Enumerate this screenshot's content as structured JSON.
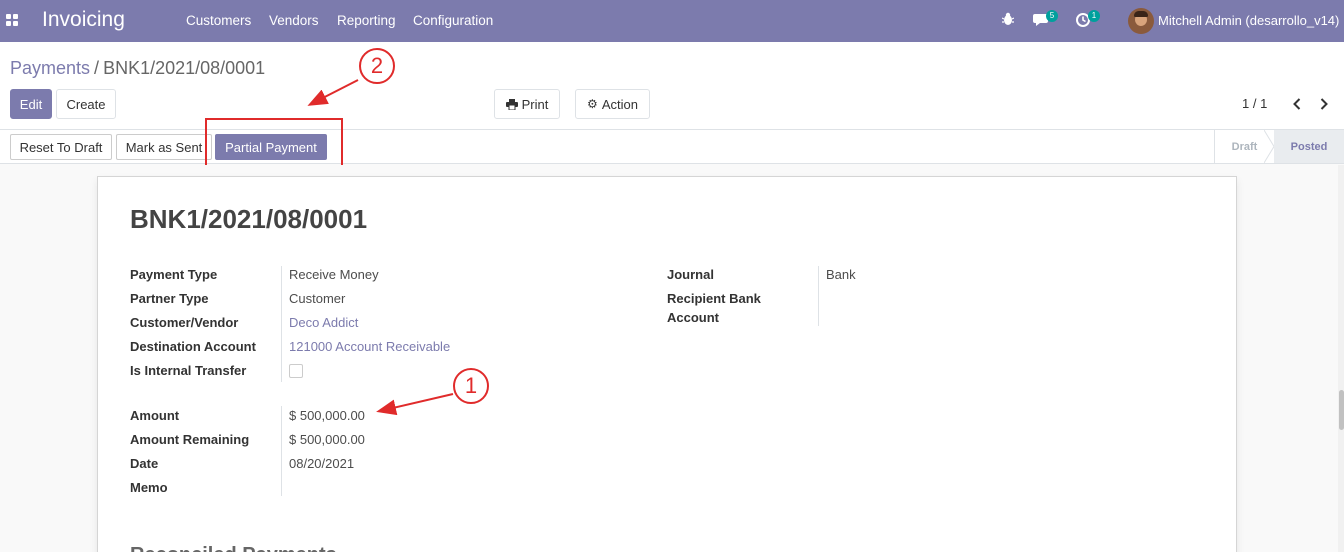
{
  "navbar": {
    "app_name": "Invoicing",
    "menus": [
      "Customers",
      "Vendors",
      "Reporting",
      "Configuration"
    ],
    "messages_count": "5",
    "activities_count": "1",
    "user": "Mitchell Admin (desarrollo_v14)",
    "icons": [
      "apps-icon",
      "bug-icon",
      "chat-icon",
      "clock-icon"
    ]
  },
  "breadcrumb": {
    "parent": "Payments",
    "separator": "/",
    "current": "BNK1/2021/08/0001"
  },
  "actions": {
    "edit": "Edit",
    "create": "Create",
    "print": "Print",
    "action": "Action"
  },
  "pager": {
    "value": "1 / 1"
  },
  "statusbar": {
    "reset_to_draft": "Reset To Draft",
    "mark_as_sent": "Mark as Sent",
    "partial_payment": "Partial Payment",
    "stages": [
      "Draft",
      "Posted"
    ],
    "active_stage": "Posted"
  },
  "record": {
    "title": "BNK1/2021/08/0001",
    "left_fields": [
      {
        "label": "Payment Type",
        "value": "Receive Money"
      },
      {
        "label": "Partner Type",
        "value": "Customer"
      },
      {
        "label": "Customer/Vendor",
        "value": "Deco Addict"
      },
      {
        "label": "Destination Account",
        "value": "121000 Account Receivable"
      },
      {
        "label": "Is Internal Transfer",
        "value": ""
      }
    ],
    "amount_fields": [
      {
        "label": "Amount",
        "value": "$ 500,000.00"
      },
      {
        "label": "Amount Remaining",
        "value": "$ 500,000.00"
      },
      {
        "label": "Date",
        "value": "08/20/2021"
      },
      {
        "label": "Memo",
        "value": ""
      }
    ],
    "right_fields": {
      "journal_label": "Journal",
      "journal_value": "Bank",
      "recipient_label_1": "Recipient Bank",
      "recipient_label_2": "Account"
    },
    "next_section": "Reconciled Payments"
  },
  "annotations": {
    "callout_1": "1",
    "callout_2": "2",
    "color": "#e02b2b"
  },
  "colors": {
    "brand": "#7c7bad",
    "badge": "#00a09d"
  }
}
